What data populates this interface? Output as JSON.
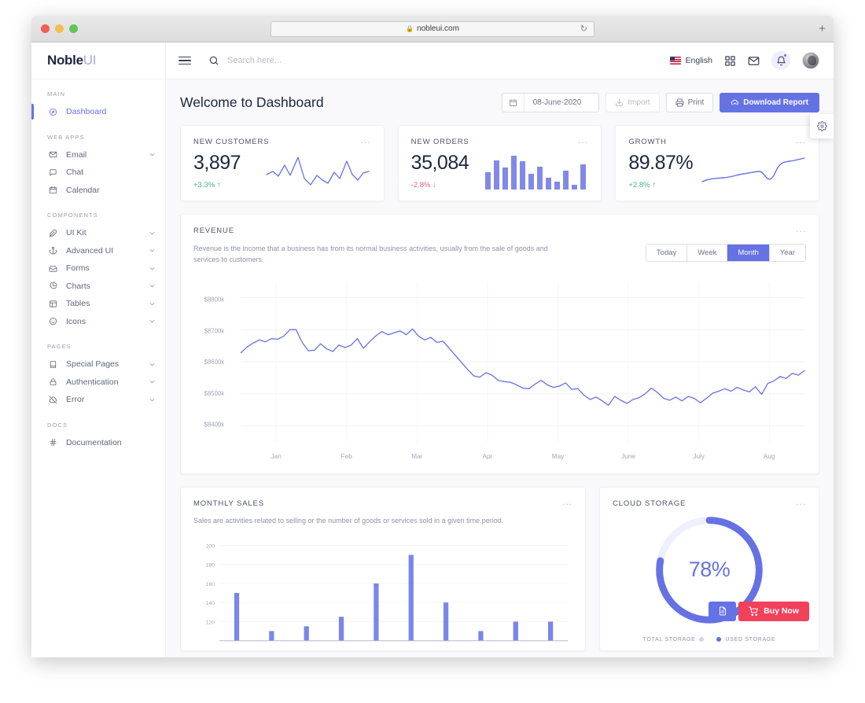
{
  "browser": {
    "url": "nobleui.com",
    "lock_icon": "lock-icon",
    "reload_icon": "reload-icon",
    "new_tab_icon": "plus-icon"
  },
  "brand": {
    "name_bold": "Noble",
    "name_light": "UI"
  },
  "topbar": {
    "menu_icon": "hamburger-icon",
    "search_icon": "search-icon",
    "search_placeholder": "Search here...",
    "search_value": "",
    "language": "English",
    "flag_icon": "us-flag-icon",
    "apps_icon": "grid-apps-icon",
    "mail_icon": "mail-icon",
    "bell_icon": "bell-icon",
    "avatar_icon": "user-avatar"
  },
  "sidebar": {
    "groups": [
      {
        "label": "MAIN",
        "items": [
          {
            "label": "Dashboard",
            "icon": "compass-icon",
            "active": true,
            "caret": false
          }
        ]
      },
      {
        "label": "WEB APPS",
        "items": [
          {
            "label": "Email",
            "icon": "mail-icon",
            "active": false,
            "caret": true
          },
          {
            "label": "Chat",
            "icon": "chat-bubble-icon",
            "active": false,
            "caret": false
          },
          {
            "label": "Calendar",
            "icon": "calendar-icon",
            "active": false,
            "caret": false
          }
        ]
      },
      {
        "label": "COMPONENTS",
        "items": [
          {
            "label": "UI Kit",
            "icon": "feather-icon",
            "active": false,
            "caret": true
          },
          {
            "label": "Advanced UI",
            "icon": "anchor-icon",
            "active": false,
            "caret": true
          },
          {
            "label": "Forms",
            "icon": "inbox-icon",
            "active": false,
            "caret": true
          },
          {
            "label": "Charts",
            "icon": "pie-chart-icon",
            "active": false,
            "caret": true
          },
          {
            "label": "Tables",
            "icon": "table-icon",
            "active": false,
            "caret": true
          },
          {
            "label": "Icons",
            "icon": "smiley-icon",
            "active": false,
            "caret": true
          }
        ]
      },
      {
        "label": "PAGES",
        "items": [
          {
            "label": "Special Pages",
            "icon": "book-icon",
            "active": false,
            "caret": true
          },
          {
            "label": "Authentication",
            "icon": "lock-icon",
            "active": false,
            "caret": true
          },
          {
            "label": "Error",
            "icon": "cloud-off-icon",
            "active": false,
            "caret": true
          }
        ]
      },
      {
        "label": "DOCS",
        "items": [
          {
            "label": "Documentation",
            "icon": "hash-icon",
            "active": false,
            "caret": false
          }
        ]
      }
    ]
  },
  "page": {
    "title": "Welcome to Dashboard",
    "date_value": "08-June-2020",
    "date_icon": "calendar-icon",
    "import_label": "Import",
    "import_icon": "download-icon",
    "print_label": "Print",
    "print_icon": "printer-icon",
    "download_label": "Download Report",
    "download_icon": "cloud-download-icon",
    "settings_icon": "gear-icon",
    "menu_dots": "..."
  },
  "stats": [
    {
      "title": "NEW CUSTOMERS",
      "value": "3,897",
      "delta": "+3.3%",
      "delta_dir": "up",
      "delta_arrow": "↑",
      "chart_kind": "line"
    },
    {
      "title": "NEW ORDERS",
      "value": "35,084",
      "delta": "-2.8%",
      "delta_dir": "down",
      "delta_arrow": "↓",
      "chart_kind": "bar"
    },
    {
      "title": "GROWTH",
      "value": "89.87%",
      "delta": "+2.8%",
      "delta_dir": "up",
      "delta_arrow": "↑",
      "chart_kind": "line"
    }
  ],
  "revenue": {
    "title": "REVENUE",
    "description": "Revenue is the income that a business has from its normal business activities, usually from the sale of goods and services to customers.",
    "ranges": [
      "Today",
      "Week",
      "Month",
      "Year"
    ],
    "active_range": "Month"
  },
  "sales": {
    "title": "MONTHLY SALES",
    "description": "Sales are activities related to selling or the number of goods or services sold in a given time period."
  },
  "cloud": {
    "title": "CLOUD STORAGE",
    "percent_label": "78%",
    "percent": 78,
    "doc_icon": "file-icon",
    "buy_label": "Buy Now",
    "cart_icon": "shopping-cart-icon",
    "legend": [
      {
        "label": "TOTAL STORAGE",
        "color": "#cdd2f5"
      },
      {
        "label": "USED STORAGE",
        "color": "#6572e4"
      }
    ]
  },
  "colors": {
    "accent": "#6572e4",
    "success": "#3fb28c",
    "danger": "#e5637d",
    "buy_red": "#f2415a",
    "text_dark": "#1c2640",
    "text_muted": "#8e93a8"
  },
  "chart_data": [
    {
      "type": "line",
      "name": "new-customers-sparkline",
      "title": "NEW CUSTOMERS",
      "x": [
        0,
        1,
        2,
        3,
        4,
        5,
        6,
        7,
        8,
        9,
        10,
        11,
        12,
        13,
        14,
        15,
        16,
        17,
        18
      ],
      "values": [
        42,
        48,
        38,
        62,
        40,
        86,
        32,
        18,
        40,
        30,
        22,
        46,
        30,
        72,
        40,
        30,
        44,
        32,
        50
      ],
      "ylim": [
        0,
        100
      ],
      "grid": false,
      "legend": null
    },
    {
      "type": "bar",
      "name": "new-orders-bars",
      "title": "NEW ORDERS",
      "categories": [
        "1",
        "2",
        "3",
        "4",
        "5",
        "6",
        "7",
        "8",
        "9",
        "10",
        "11"
      ],
      "values": [
        46,
        78,
        60,
        92,
        80,
        42,
        62,
        30,
        20,
        52,
        12,
        70
      ],
      "ylim": [
        0,
        100
      ],
      "grid": false
    },
    {
      "type": "line",
      "name": "growth-sparkline",
      "title": "GROWTH",
      "x": [
        0,
        1,
        2,
        3,
        4,
        5,
        6,
        7,
        8,
        9,
        10
      ],
      "values": [
        22,
        28,
        30,
        32,
        36,
        46,
        48,
        40,
        28,
        70,
        78
      ],
      "ylim": [
        0,
        100
      ],
      "grid": false
    },
    {
      "type": "line",
      "name": "revenue-chart",
      "title": "REVENUE",
      "xlabel": "",
      "ylabel": "",
      "categories": [
        "Jan",
        "Feb",
        "Mar",
        "Apr",
        "May",
        "June",
        "July",
        "Aug"
      ],
      "ytick_labels": [
        "$8800k",
        "$8700k",
        "$8600k",
        "$8500k",
        "$8400k"
      ],
      "ylim": [
        8350,
        8850
      ],
      "grid": true,
      "legend": null,
      "series": [
        {
          "name": "Revenue",
          "color": "#6572e4",
          "values": [
            8628,
            8646,
            8658,
            8668,
            8662,
            8672,
            8670,
            8680,
            8700,
            8700,
            8660,
            8634,
            8636,
            8656,
            8640,
            8632,
            8652,
            8644,
            8652,
            8672,
            8642,
            8662,
            8680,
            8694,
            8684,
            8690,
            8696,
            8684,
            8702,
            8680,
            8668,
            8676,
            8660,
            8664,
            8642,
            8620,
            8598,
            8576,
            8556,
            8552,
            8566,
            8558,
            8542,
            8538,
            8536,
            8528,
            8518,
            8516,
            8530,
            8542,
            8528,
            8520,
            8524,
            8534,
            8514,
            8516,
            8496,
            8482,
            8490,
            8478,
            8464,
            8492,
            8480,
            8470,
            8482,
            8488,
            8500,
            8518,
            8504,
            8486,
            8480,
            8490,
            8478,
            8492,
            8486,
            8472,
            8486,
            8502,
            8508,
            8516,
            8508,
            8520,
            8512,
            8506,
            8522,
            8498,
            8532,
            8540,
            8554,
            8548,
            8564,
            8558,
            8572
          ]
        }
      ]
    },
    {
      "type": "bar",
      "name": "monthly-sales-bars",
      "title": "MONTHLY SALES",
      "ytick_labels": [
        "200",
        "180",
        "160",
        "140",
        "120"
      ],
      "ylim": [
        100,
        205
      ],
      "grid": true,
      "categories": [
        "1",
        "2",
        "3",
        "4",
        "5",
        "6",
        "7",
        "8",
        "9",
        "10"
      ],
      "values": [
        150,
        110,
        115,
        125,
        160,
        190,
        140,
        110,
        120,
        120
      ]
    },
    {
      "type": "pie",
      "name": "cloud-storage-donut",
      "title": "CLOUD STORAGE",
      "labels": [
        "USED STORAGE",
        "TOTAL STORAGE"
      ],
      "values": [
        78,
        22
      ],
      "colors": [
        "#6572e4",
        "#eef0fb"
      ]
    }
  ]
}
